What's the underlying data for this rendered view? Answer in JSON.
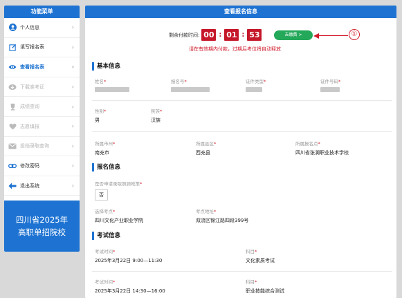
{
  "sidebar": {
    "title": "功能菜单",
    "items": [
      {
        "label": "个人信息",
        "icon": "user-icon",
        "state": "normal"
      },
      {
        "label": "填写报名表",
        "icon": "edit-form-icon",
        "state": "normal"
      },
      {
        "label": "查看报名表",
        "icon": "eye-icon",
        "state": "active"
      },
      {
        "label": "下载准考证",
        "icon": "download-icon",
        "state": "disabled"
      },
      {
        "label": "成绩查询",
        "icon": "trophy-icon",
        "state": "disabled"
      },
      {
        "label": "志愿填报",
        "icon": "heart-icon",
        "state": "disabled"
      },
      {
        "label": "投档录取查询",
        "icon": "mail-icon",
        "state": "disabled"
      },
      {
        "label": "修改密码",
        "icon": "link-icon",
        "state": "normal"
      },
      {
        "label": "退出系统",
        "icon": "exit-icon",
        "state": "normal"
      }
    ],
    "banner_line1": "四川省2025年",
    "banner_line2": "高职单招院校"
  },
  "main": {
    "title": "查看报名信息",
    "timer": {
      "label": "剩余付款时间:",
      "hours": "00",
      "minutes": "01",
      "seconds": "53",
      "note": "请在有效期内付款，过期后考位将自动释放"
    },
    "pay_button": "去缴费 >",
    "marker": "①",
    "sections": {
      "basic": {
        "title": "基本信息",
        "name_label": "姓名",
        "reg_no_label": "报名号",
        "id_type_label": "证件类型",
        "id_no_label": "证件号码",
        "gender_label": "性别",
        "gender_value": "男",
        "ethnicity_label": "民族",
        "ethnicity_value": "汉族",
        "city_label": "所属市州",
        "city_value": "南充市",
        "county_label": "所属县区",
        "county_value": "西充县",
        "site_label": "所属报名点",
        "site_value": "四川省张澜职业技术学校"
      },
      "registration": {
        "title": "报名信息",
        "policy_label": "是否申请录取照顾政策",
        "policy_value": "否",
        "exam_site_label": "选择考点",
        "exam_site_value": "四川文化产业职业学院",
        "exam_addr_label": "考点地址",
        "exam_addr_value": "双流区锦江路四段399号"
      },
      "exam": {
        "title": "考试信息",
        "time_label": "考试时间",
        "subject_label": "科目",
        "time1_value": "2025年3月22日 9:00—11:30",
        "subject1_value": "文化素质考试",
        "time2_value": "2025年3月22日 14:30—16:00",
        "subject2_value": "职业技能综合测试"
      }
    }
  },
  "colors": {
    "primary": "#1e73d2",
    "timer_red": "#c6172a",
    "pay_green": "#24a85a",
    "disabled": "#b5b5b5"
  }
}
